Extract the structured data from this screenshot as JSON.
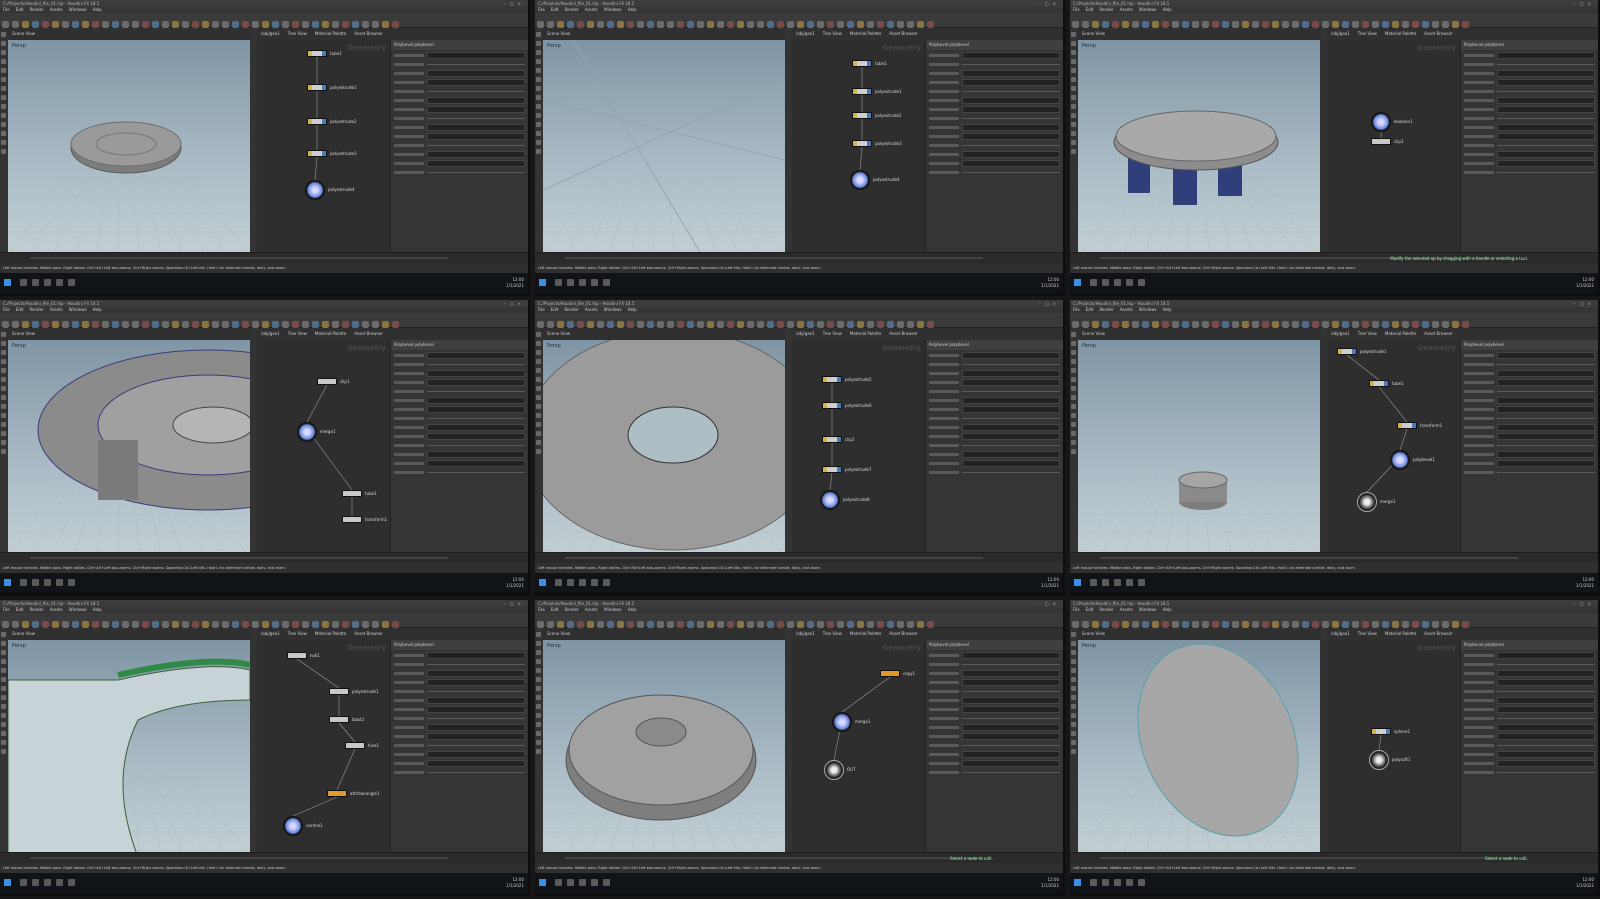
{
  "app": {
    "window_title": "C:/Projects/Houdini_file_01.hip - Houdini FX 18.5",
    "window_buttons": "–□×",
    "menus": [
      "File",
      "Edit",
      "Render",
      "Assets",
      "Windows",
      "Help"
    ],
    "viewport_tab": "Scene View",
    "viewport_label": "Persp",
    "network_tabs": [
      "/obj/geo1",
      "Tree View",
      "Material Palette",
      "Asset Browser"
    ],
    "network_context": "Geometry",
    "param_header": "Polybevel polybevel",
    "statusbar_text": "Left mouse tumbles. Middle pans. Right dollies. Ctrl+Alt+Left box-zooms. Ctrl+Right zooms. Spacebar-Ctrl-Left tilts. Hold L for alternate tumble, dolly, and zoom.",
    "clock_time": "12:00",
    "clock_date": "1/1/2021"
  },
  "panels": [
    {
      "id": "p1",
      "nodes": [
        {
          "label": "tube1",
          "type": "flag"
        },
        {
          "label": "polyextrude1",
          "type": "flag"
        },
        {
          "label": "polyextrude2",
          "type": "flag"
        },
        {
          "label": "polyextrude3",
          "type": "flag"
        },
        {
          "label": "polyextrude4",
          "type": "disp"
        }
      ]
    },
    {
      "id": "p2",
      "nodes": [
        {
          "label": "tube1",
          "type": "flag"
        },
        {
          "label": "polyextrude1",
          "type": "flag"
        },
        {
          "label": "polyextrude2",
          "type": "flag"
        },
        {
          "label": "polyextrude3",
          "type": "flag"
        },
        {
          "label": "polyextrude4",
          "type": "disp"
        }
      ]
    },
    {
      "id": "p3",
      "nodes": [
        {
          "label": "boolean1",
          "type": "disp"
        },
        {
          "label": "clip1",
          "type": "plain"
        }
      ],
      "status_msg": "Modify the selected op by dragging with a handle or selecting a tool."
    },
    {
      "id": "p4",
      "nodes": [
        {
          "label": "clip1",
          "type": "plain"
        },
        {
          "label": "merge1",
          "type": "disp"
        },
        {
          "label": "tube1",
          "type": "plain"
        },
        {
          "label": "transform1",
          "type": "plain"
        }
      ]
    },
    {
      "id": "p5",
      "nodes": [
        {
          "label": "polyextrude5",
          "type": "flag"
        },
        {
          "label": "polyextrude6",
          "type": "flag"
        },
        {
          "label": "clip2",
          "type": "flag"
        },
        {
          "label": "polyextrude7",
          "type": "flag"
        },
        {
          "label": "polyextrude8",
          "type": "disp"
        }
      ]
    },
    {
      "id": "p6",
      "nodes": [
        {
          "label": "polyextrude1",
          "type": "flag"
        },
        {
          "label": "tube1",
          "type": "flag"
        },
        {
          "label": "transform1",
          "type": "flag"
        },
        {
          "label": "polybevel1",
          "type": "disp"
        },
        {
          "label": "merge1",
          "type": "out"
        }
      ]
    },
    {
      "id": "p7",
      "nodes": [
        {
          "label": "null1",
          "type": "plain"
        },
        {
          "label": "polyextrude1",
          "type": "plain"
        },
        {
          "label": "blast1",
          "type": "plain"
        },
        {
          "label": "fuse1",
          "type": "plain"
        },
        {
          "label": "attribwrangle1",
          "type": "orange"
        },
        {
          "label": "normal1",
          "type": "disp"
        }
      ]
    },
    {
      "id": "p8",
      "nodes": [
        {
          "label": "copy1",
          "type": "orange"
        },
        {
          "label": "merge1",
          "type": "disp"
        },
        {
          "label": "OUT",
          "type": "out"
        }
      ],
      "status_msg": "Select a node to edit."
    },
    {
      "id": "p9",
      "nodes": [
        {
          "label": "sphere1",
          "type": "flag"
        },
        {
          "label": "polysoft1",
          "type": "out"
        }
      ],
      "status_msg": "Select a node to edit."
    }
  ]
}
